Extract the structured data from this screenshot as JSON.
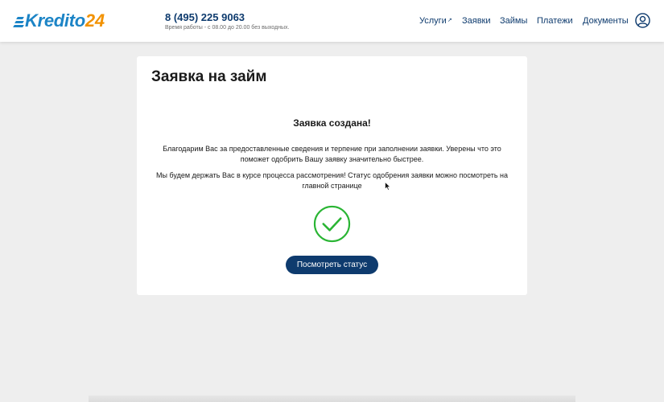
{
  "header": {
    "logo": {
      "text": "Kredito",
      "number": "24"
    },
    "phone": "8 (495) 225 9063",
    "hours": "Время работы - с 08.00 до 20.00 без выходных.",
    "nav": [
      {
        "label": "Услуги",
        "external": true
      },
      {
        "label": "Заявки"
      },
      {
        "label": "Займы"
      },
      {
        "label": "Платежи"
      },
      {
        "label": "Документы"
      }
    ],
    "user_icon": "user-circle-icon"
  },
  "card": {
    "title": "Заявка на займ",
    "status_title": "Заявка создана!",
    "paragraph1": "Благодарим Вас за предоставленные сведения и терпение при заполнении заявки. Уверены что это поможет одобрить Вашу заявку значительно быстрее.",
    "paragraph2": "Мы будем держать Вас в курсе процесса рассмотрения! Статус одобрения заявки можно посмотреть на главной странице",
    "check_icon": "check-circle-icon",
    "button_label": "Посмотреть статус"
  },
  "colors": {
    "brand_blue": "#1c84c6",
    "brand_orange": "#f29200",
    "navy": "#0e3b6e",
    "success_green": "#2ab534",
    "background": "#eeeeee"
  }
}
